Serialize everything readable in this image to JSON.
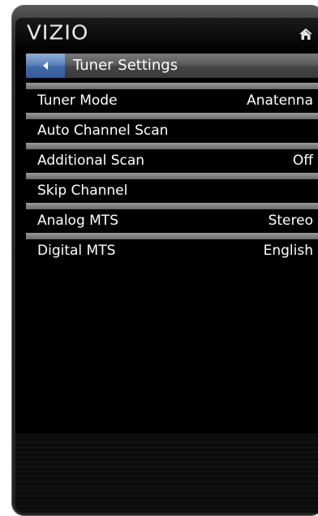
{
  "header": {
    "brand": "VIZIO",
    "home_icon": "home-icon"
  },
  "title_bar": {
    "back_icon": "back-arrow-icon",
    "title": "Tuner Settings"
  },
  "menu": {
    "items": [
      {
        "label": "Tuner Mode",
        "value": "Anatenna"
      },
      {
        "label": "Auto Channel Scan",
        "value": ""
      },
      {
        "label": "Additional Scan",
        "value": "Off"
      },
      {
        "label": "Skip Channel",
        "value": ""
      },
      {
        "label": "Analog MTS",
        "value": "Stereo"
      },
      {
        "label": "Digital MTS",
        "value": "English"
      }
    ]
  },
  "colors": {
    "accent": "#4a74b2",
    "background": "#000000",
    "text": "#ffffff"
  }
}
